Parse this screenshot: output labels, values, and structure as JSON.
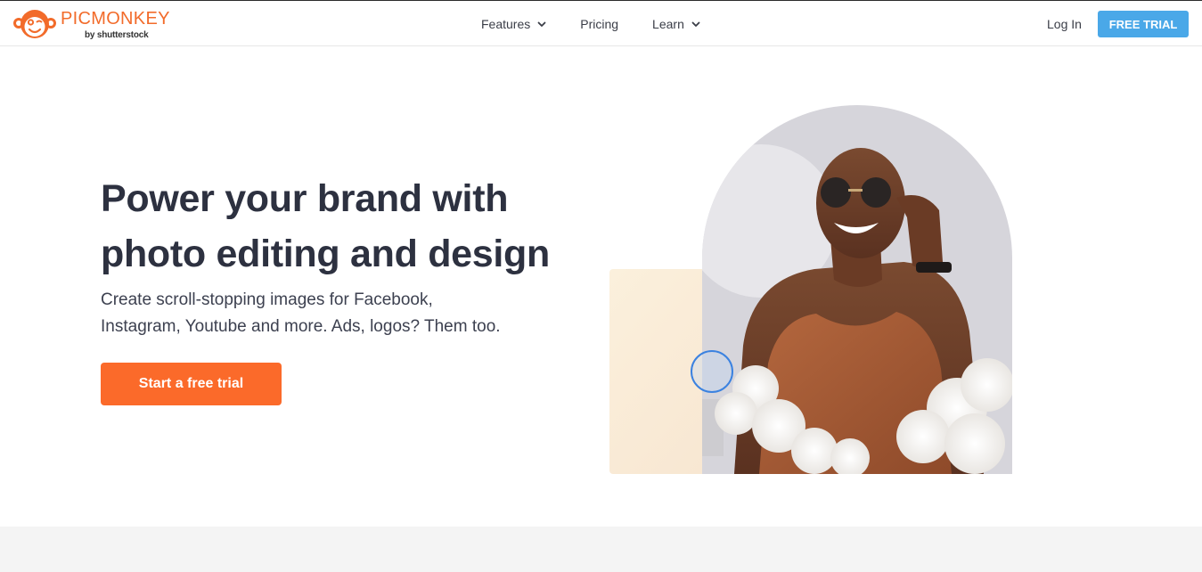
{
  "brand": {
    "name": "PICMONKEY",
    "byline": "by shutterstock",
    "accent_color": "#f26b2a",
    "logo_icon": "monkey-face-icon"
  },
  "nav": {
    "items": [
      {
        "label": "Features",
        "has_dropdown": true
      },
      {
        "label": "Pricing",
        "has_dropdown": false
      },
      {
        "label": "Learn",
        "has_dropdown": true
      }
    ],
    "login_label": "Log In",
    "free_trial_label": "FREE TRIAL",
    "free_trial_color": "#4aa8e8"
  },
  "hero": {
    "title_line1": "Power your brand with",
    "title_line2": "photo editing and design",
    "subtitle_line1": "Create scroll-stopping images for Facebook,",
    "subtitle_line2": "Instagram, Youtube and more. Ads, logos? Them too.",
    "cta_label": "Start a free trial",
    "cta_color": "#fb6a2a"
  }
}
